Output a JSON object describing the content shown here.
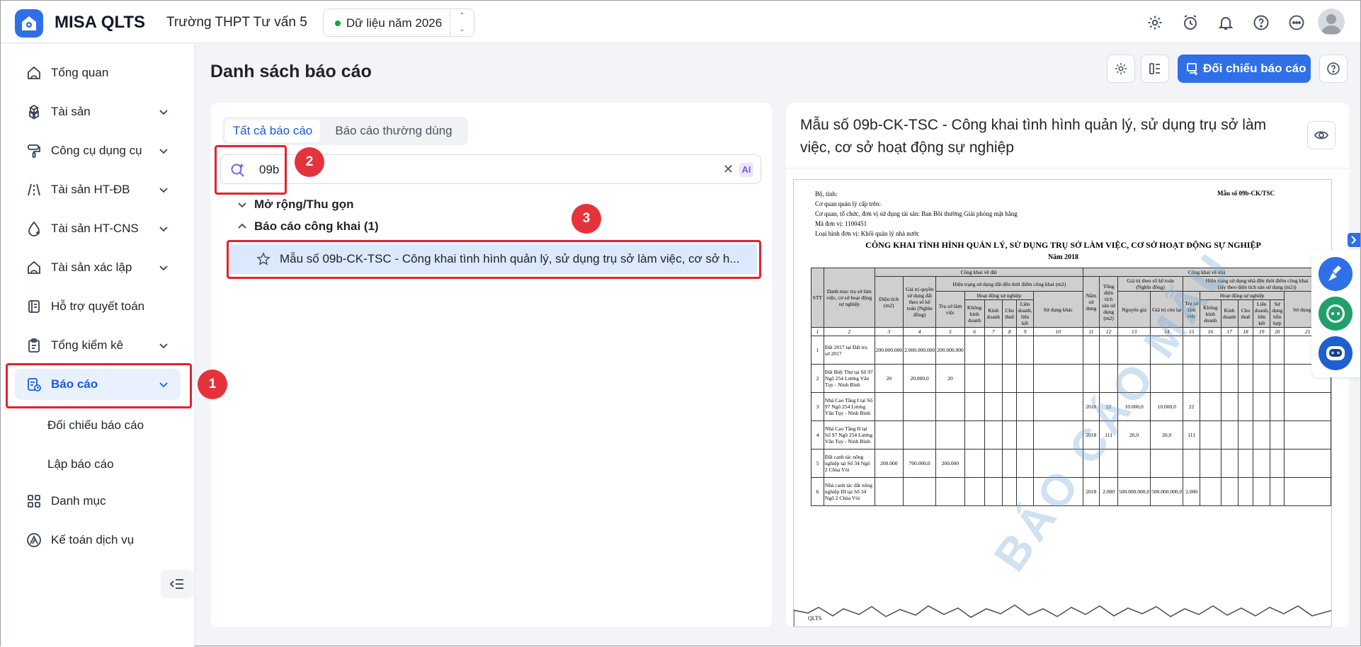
{
  "header": {
    "app_name": "MISA QLTS",
    "org_name": "Trường THPT Tư vấn 5",
    "data_year": "Dữ liệu năm 2026",
    "icons": [
      "gear-icon",
      "alarm-clock-icon",
      "bell-icon",
      "help-icon",
      "more-icon",
      "avatar"
    ]
  },
  "sidebar": {
    "items": [
      {
        "label": "Tổng quan",
        "icon": "home-icon",
        "expandable": false
      },
      {
        "label": "Tài sản",
        "icon": "boxes-icon",
        "expandable": true
      },
      {
        "label": "Công cụ dụng cụ",
        "icon": "paint-roller-icon",
        "expandable": true
      },
      {
        "label": "Tài sản HT-ĐB",
        "icon": "road-icon",
        "expandable": true
      },
      {
        "label": "Tài sản HT-CNS",
        "icon": "water-drop-icon",
        "expandable": true
      },
      {
        "label": "Tài sản xác lập",
        "icon": "home-icon",
        "expandable": true
      },
      {
        "label": "Hỗ trợ quyết toán",
        "icon": "book-icon",
        "expandable": false
      },
      {
        "label": "Tổng kiểm kê",
        "icon": "clipboard-icon",
        "expandable": true
      },
      {
        "label": "Báo cáo",
        "icon": "report-icon",
        "expandable": true,
        "active": true
      },
      {
        "label": "Danh mục",
        "icon": "grid-icon",
        "expandable": false
      },
      {
        "label": "Kế toán dịch vụ",
        "icon": "triangle-logo-icon",
        "expandable": false
      }
    ],
    "sub_items": [
      "Đối chiếu báo cáo",
      "Lập báo cáo"
    ]
  },
  "main": {
    "page_title": "Danh sách báo cáo",
    "primary_button": "Đối chiếu báo cáo",
    "tabs": [
      "Tất cả báo cáo",
      "Báo cáo thường dùng"
    ],
    "search": {
      "value": "09b",
      "ai_label": "AI"
    },
    "tree": {
      "toggle_label": "Mở rộng/Thu gọn",
      "group_label": "Báo cáo công khai (1)",
      "report_item": "Mẫu số 09b-CK-TSC - Công khai tình hình quản lý, sử dụng trụ sở làm việc, cơ sở h..."
    }
  },
  "preview": {
    "title": "Mẫu số 09b-CK-TSC - Công khai tình hình quản lý, sử dụng trụ sở làm việc, cơ sở hoạt động sự nghiệp",
    "doc": {
      "header_lines": [
        "Bộ, tỉnh:",
        "Cơ quan quản lý cấp trên:",
        "Cơ quan, tổ chức, đơn vị sử dụng tài sản: Ban Bồi thường Giải phóng mặt bằng",
        "Mã đơn vị: 1100451",
        "Loại hình đơn vị: Khối quản lý nhà nước"
      ],
      "form_no": "Mẫu số 09b-CK/TSC",
      "title": "CÔNG KHAI TÌNH HÌNH QUẢN LÝ, SỬ DỤNG TRỤ SỞ LÀM VIỆC, CƠ SỞ HOẠT ĐỘNG SỰ NGHIỆP",
      "year": "Năm 2018",
      "watermark": "BÁO CÁO MẪU",
      "header_labels": {
        "stt": "STT",
        "danh_muc": "Danh mục trụ sở làm việc, cơ sở hoạt động sự nghiệp",
        "ck_dat": "Công khai về đất",
        "ck_nha": "Công khai về nhà",
        "dien_tich": "Diện tích (m2)",
        "gia_tri_qsd": "Giá trị quyền sử dụng đất theo sổ kế toán (Nghìn đồng)",
        "hien_trang_dat": "Hiện trạng sử dụng đất đến thời điểm công khai (m2)",
        "nam_sd": "Năm sử dụng",
        "tong_dt_san": "Tổng diện tích sàn sử dụng (m2)",
        "gia_tri_so": "Giá trị theo sổ kế toán (Nghìn đồng)",
        "hien_trang_nha": "Hiện trạng sử dụng nhà đến thời điểm công khai",
        "hien_trang_nha_sub": "(lấy theo diện tích sàn sử dụng (m2))",
        "tru_so": "Trụ sở làm việc",
        "hd_su_nghiep": "Hoạt động sự nghiệp",
        "khong_kd": "Không kinh doanh",
        "kinh_doanh": "Kinh doanh",
        "cho_thue": "Cho thuê",
        "lien_doanh": "Liên doanh, liên kết",
        "su_dung_khac": "Sử dụng khác",
        "nguyen_gia": "Nguyên giá",
        "gia_tri_con_lai": "Giá trị còn lại",
        "su_dung_hon_hop": "Sử dụng hỗn hợp"
      },
      "col_numbers": [
        "1",
        "2",
        "3",
        "4",
        "5",
        "6",
        "7",
        "8",
        "9",
        "10",
        "11",
        "12",
        "13",
        "14",
        "15",
        "16",
        "17",
        "18",
        "19",
        "20",
        "21"
      ],
      "rows": [
        {
          "stt": "1",
          "name": "Đất 2017 tại Đất trụ sở 2017",
          "dt": "200.000.000",
          "gt": "2.000.000.000",
          "ts": "200.000.000",
          "nam": "",
          "tdt": "",
          "ng": "",
          "gtcl": "",
          "tsn": ""
        },
        {
          "stt": "2",
          "name": "Đất Biệt Thự tại Số 97 Ngõ 254 Lương Văn Tụy - Ninh Bình",
          "dt": "20",
          "gt": "20.000,0",
          "ts": "20",
          "nam": "",
          "tdt": "",
          "ng": "",
          "gtcl": "",
          "tsn": ""
        },
        {
          "stt": "3",
          "name": "Nhà Cao Tầng I tại Số 97 Ngõ 254 Lương Văn Tụy - Ninh Bình",
          "dt": "",
          "gt": "",
          "ts": "",
          "nam": "2018",
          "tdt": "22",
          "ng": "10.000,0",
          "gtcl": "10.000,0",
          "tsn": "22"
        },
        {
          "stt": "4",
          "name": "Nhà Cao Tầng II tại Số 97 Ngõ 254 Lương Văn Tụy - Ninh Bình",
          "dt": "",
          "gt": "",
          "ts": "",
          "nam": "2018",
          "tdt": "111",
          "ng": "20,0",
          "gtcl": "20,0",
          "tsn": "111"
        },
        {
          "stt": "5",
          "name": "Đất canh tác nông nghiệp tại Số 34 Ngõ 2 Chùa Vòi",
          "dt": "200.000",
          "gt": "700.000,0",
          "ts": "200.000",
          "nam": "",
          "tdt": "",
          "ng": "",
          "gtcl": "",
          "tsn": ""
        },
        {
          "stt": "6",
          "name": "Nhà canh tác đất nông nghiệp III tại Số 34 Ngõ 2 Chùa Vòi",
          "dt": "",
          "gt": "",
          "ts": "",
          "nam": "2018",
          "tdt": "2.000",
          "ng": "500.000.000,0",
          "gtcl": "500.000.000,0",
          "tsn": "2.000"
        }
      ],
      "footer_text": "QLTS"
    }
  },
  "annotations": [
    "1",
    "2",
    "3"
  ],
  "colors": {
    "primary": "#2f6fe8",
    "active_bg": "#eaf1fe",
    "annotation": "#e0242f"
  }
}
